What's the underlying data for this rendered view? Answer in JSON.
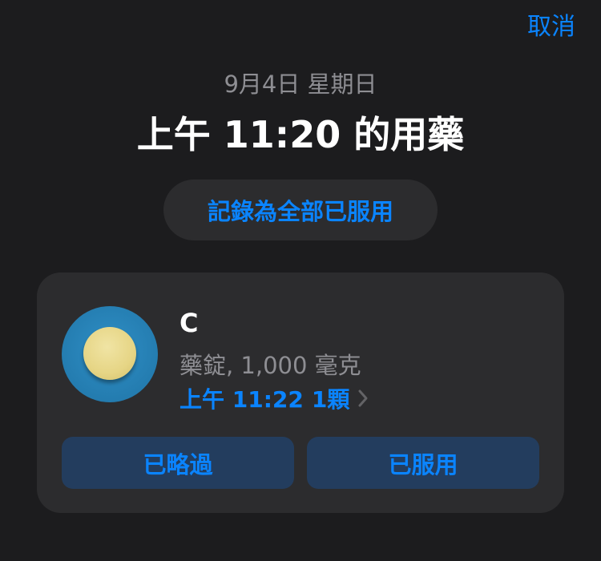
{
  "header": {
    "cancel_label": "取消",
    "date": "9月4日 星期日",
    "title": "上午 11:20 的用藥"
  },
  "actions": {
    "log_all_label": "記錄為全部已服用"
  },
  "medication": {
    "name": "C",
    "detail": "藥錠, 1,000 毫克",
    "dose_time": "上午 11:22",
    "dose_amount": "1顆",
    "icon": "round-pill-icon",
    "icon_bg_color": "#2383b8",
    "pill_color": "#e6d585"
  },
  "buttons": {
    "skipped_label": "已略過",
    "taken_label": "已服用"
  },
  "colors": {
    "accent": "#0a84ff",
    "background": "#1c1c1e",
    "card": "#2c2c2e",
    "button_bg": "#233d5e"
  }
}
